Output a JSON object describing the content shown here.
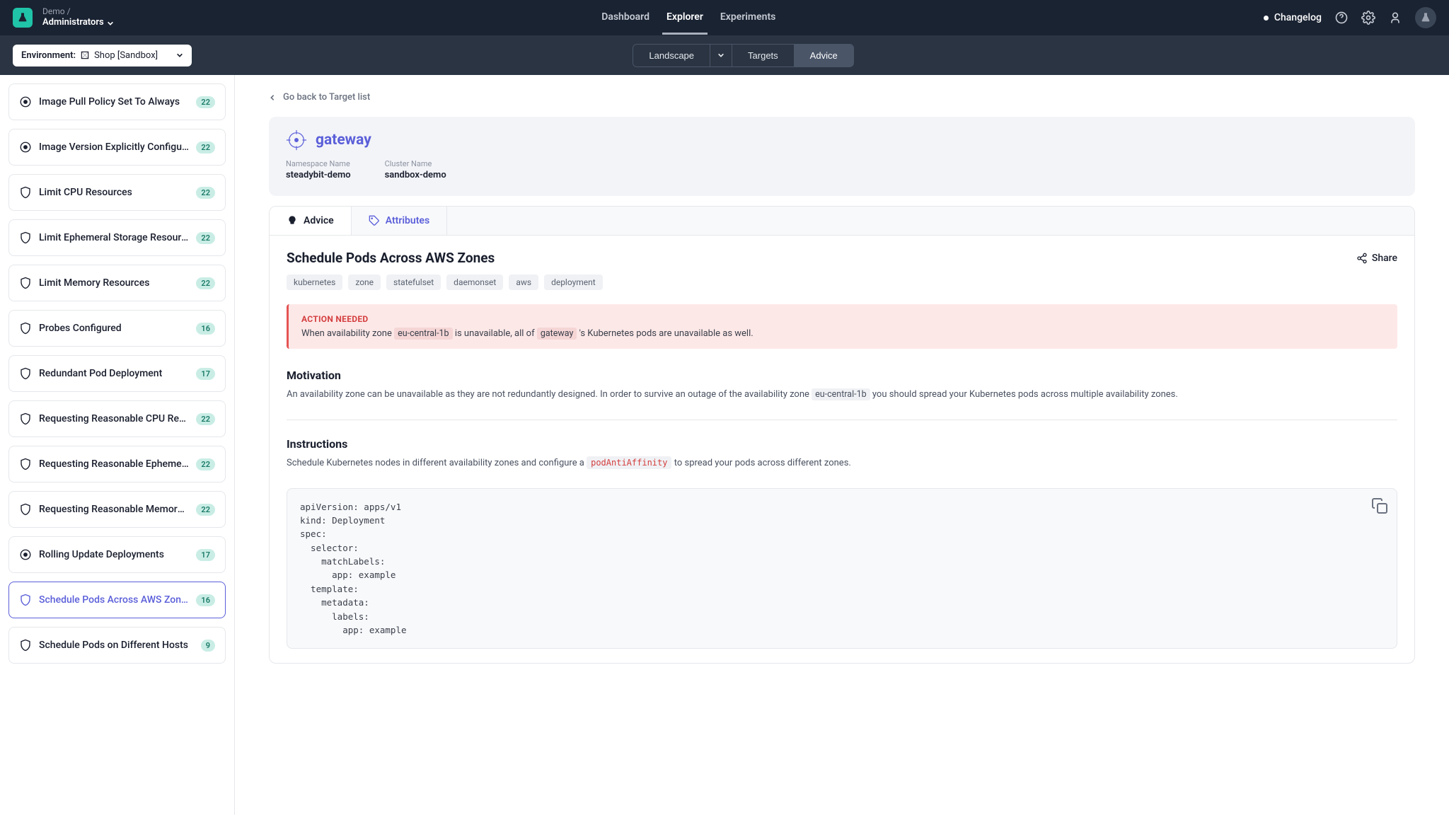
{
  "header": {
    "breadcrumb_top": "Demo /",
    "breadcrumb_bottom": "Administrators",
    "nav": {
      "dashboard": "Dashboard",
      "explorer": "Explorer",
      "experiments": "Experiments"
    },
    "changelog": "Changelog"
  },
  "subbar": {
    "env_label": "Environment:",
    "env_value": "Shop [Sandbox]",
    "seg": {
      "landscape": "Landscape",
      "targets": "Targets",
      "advice": "Advice"
    }
  },
  "sidebar": {
    "items": [
      {
        "label": "Image Pull Policy Set To Always",
        "count": "22",
        "icon": "circle"
      },
      {
        "label": "Image Version Explicitly Configured",
        "count": "22",
        "icon": "circle"
      },
      {
        "label": "Limit CPU Resources",
        "count": "22",
        "icon": "shield"
      },
      {
        "label": "Limit Ephemeral Storage Resources",
        "count": "22",
        "icon": "shield"
      },
      {
        "label": "Limit Memory Resources",
        "count": "22",
        "icon": "shield"
      },
      {
        "label": "Probes Configured",
        "count": "16",
        "icon": "shield"
      },
      {
        "label": "Redundant Pod Deployment",
        "count": "17",
        "icon": "shield"
      },
      {
        "label": "Requesting Reasonable CPU Resourc...",
        "count": "22",
        "icon": "shield"
      },
      {
        "label": "Requesting Reasonable Ephemeral Sto...",
        "count": "22",
        "icon": "shield"
      },
      {
        "label": "Requesting Reasonable Memory Reso...",
        "count": "22",
        "icon": "shield"
      },
      {
        "label": "Rolling Update Deployments",
        "count": "17",
        "icon": "circle"
      },
      {
        "label": "Schedule Pods Across AWS Zones",
        "count": "16",
        "icon": "shield",
        "selected": true
      },
      {
        "label": "Schedule Pods on Different Hosts",
        "count": "9",
        "icon": "shield"
      }
    ]
  },
  "content": {
    "back": "Go back to Target list",
    "hero": {
      "title": "gateway",
      "meta": [
        {
          "label": "Namespace Name",
          "value": "steadybit-demo"
        },
        {
          "label": "Cluster Name",
          "value": "sandbox-demo"
        }
      ]
    },
    "tabs": {
      "advice": "Advice",
      "attributes": "Attributes"
    },
    "detail": {
      "title": "Schedule Pods Across AWS Zones",
      "share": "Share",
      "tags": [
        "kubernetes",
        "zone",
        "statefulset",
        "daemonset",
        "aws",
        "deployment"
      ],
      "alert": {
        "title": "ACTION NEEDED",
        "pre": "When availability zone ",
        "zone": "eu-central-1b",
        "mid": " is unavailable, all of ",
        "target": "gateway",
        "post": " 's Kubernetes pods are unavailable as well."
      },
      "motivation": {
        "heading": "Motivation",
        "pre": "An availability zone can be unavailable as they are not redundantly designed. In order to survive an outage of the availability zone ",
        "zone": "eu-central-1b",
        "post": " you should spread your Kubernetes pods across multiple availability zones."
      },
      "instructions": {
        "heading": "Instructions",
        "pre": "Schedule Kubernetes nodes in different availability zones and configure a ",
        "code": "podAntiAffinity",
        "post": " to spread your pods across different zones."
      },
      "codeblock": "apiVersion: apps/v1\nkind: Deployment\nspec:\n  selector:\n    matchLabels:\n      app: example\n  template:\n    metadata:\n      labels:\n        app: example"
    }
  }
}
